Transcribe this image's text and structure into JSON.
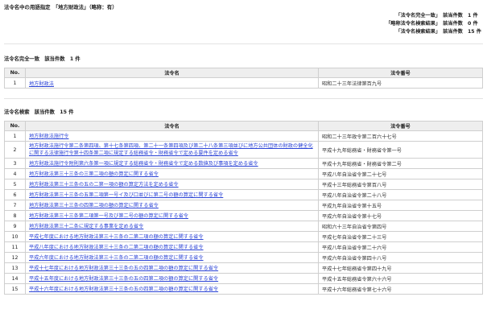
{
  "header": {
    "search_line": "法令名中の用語指定　「地方財政法」（略称：有）"
  },
  "summary": [
    {
      "label": "「法令名完全一致」　該当件数",
      "count": "1 件"
    },
    {
      "label": "「略称法令名検索結果」　該当件数",
      "count": "0 件"
    },
    {
      "label": "「法令名検索結果」　該当件数",
      "count": "15 件"
    }
  ],
  "exact": {
    "title": "法令名完全一致　該当件数　1 件",
    "columns": {
      "no": "No.",
      "name": "法令名",
      "number": "法令番号"
    },
    "rows": [
      {
        "no": "1",
        "name": "地方財政法",
        "number": "昭和二十三年法律第百九号"
      }
    ]
  },
  "search": {
    "title": "法令名検索　該当件数　15 件",
    "columns": {
      "no": "No.",
      "name": "法令名",
      "number": "法令番号"
    },
    "rows": [
      {
        "no": "1",
        "name": "地方財政法施行令",
        "number": "昭和二十三年政令第二百六十七号"
      },
      {
        "no": "2",
        "name": "地方財政法施行令第二条第四項、第十七条第四項、第二十一条第四項及び第二十八条第三項並びに地方公共団体の財政の健全化に関する法律施行令第十四条第二項に規定する総務省令・財務省令で定める要件を定める省令",
        "number": "平成十九年総務省・財務省令第一号"
      },
      {
        "no": "3",
        "name": "地方財政法施行令附則第六条第一項に規定する総務省令・財務省令で定める数値及び事項を定める省令",
        "number": "平成十九年総務省・財務省令第二号"
      },
      {
        "no": "4",
        "name": "地方財政法第三十三条の三第二項の額の算定に関する省令",
        "number": "平成八年自治省令第二十七号"
      },
      {
        "no": "5",
        "name": "地方財政法第三十三条の五の二第一項の額の算定方法を定める省令",
        "number": "平成十三年総務省令第百八号"
      },
      {
        "no": "6",
        "name": "地方財政法第三十三条の五第二項第一号イ及び口並びに第二号の額の算定に関する省令",
        "number": "平成八年自治省令第二十八号"
      },
      {
        "no": "7",
        "name": "地方財政法第三十三条の四第二項の額の算定に関する省令",
        "number": "平成九年自治省令第十五号"
      },
      {
        "no": "8",
        "name": "地方財政法第三十三条第二項第一号及び第二号の額の算定に関する省令",
        "number": "平成六年自治省令第十七号"
      },
      {
        "no": "9",
        "name": "地方財政法第三十二条に規定する事業を定める省令",
        "number": "昭和六十三年自治省令第四号"
      },
      {
        "no": "10",
        "name": "平成七年度における地方財政法第三十三条の二第二項の額の算定に関する省令",
        "number": "平成七年自治省令第二十三号"
      },
      {
        "no": "11",
        "name": "平成八年度における地方財政法第三十三条の二第二項の額の算定に関する省令",
        "number": "平成八年自治省令第二十六号"
      },
      {
        "no": "12",
        "name": "平成六年度における地方財政法第三十三条の二第二項の額の算定に関する省令",
        "number": "平成六年自治省令第四十八号"
      },
      {
        "no": "13",
        "name": "平成十七年度における地方財政法第三十三条の五の四第二項の額の算定に関する省令",
        "number": "平成十七年総務省令第四十九号"
      },
      {
        "no": "14",
        "name": "平成十五年度における地方財政法第三十三条の五の四第二項の額の算定に関する省令",
        "number": "平成十五年総務省令第六十六号"
      },
      {
        "no": "15",
        "name": "平成十六年度における地方財政法第三十三条の五の四第二項の額の算定に関する省令",
        "number": "平成十六年総務省令第七十六号"
      }
    ]
  }
}
